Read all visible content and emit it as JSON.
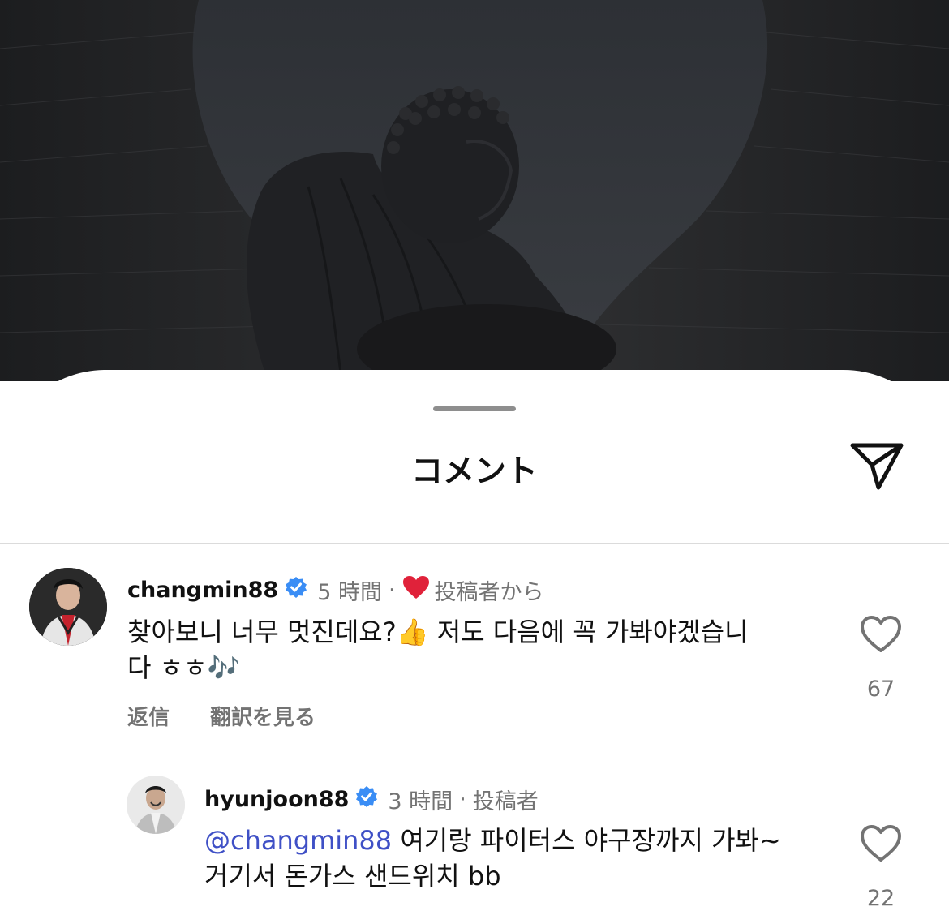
{
  "photo": {
    "description_icon": "buddha-statue-image"
  },
  "sheet": {
    "title": "コメント",
    "send_icon": "send-icon"
  },
  "comments": [
    {
      "username": "changmin88",
      "verified": true,
      "time": "5 時間",
      "separator": "·",
      "author_liked_label": "投稿者から",
      "text": "찾아보니 너무 멋진데요?👍 저도 다음에 꼭 가봐야겠습니다 ㅎㅎ🎶",
      "text_line1": "찾아보니 너무 멋진데요?",
      "text_emoji1": "👍",
      "text_line1b": " 저도 다음에 꼭 가봐야겠습니",
      "text_line2": "다 ㅎㅎ",
      "text_emoji2": "🎶",
      "reply_label": "返信",
      "translate_label": "翻訳を見る",
      "likes": "67"
    },
    {
      "username": "hyunjoon88",
      "verified": true,
      "time": "3 時間",
      "separator": "·",
      "author_label": "投稿者",
      "mention": "@changmin88",
      "text_line1": " 여기랑 파이터스 야구장까지 가봐~",
      "text_line2": "거기서 돈가스 샌드위치 bb",
      "likes": "22"
    }
  ],
  "colors": {
    "accent_mention": "#3f50c6",
    "verified_blue": "#3a8df5",
    "heart_red": "#e0223a",
    "muted_text": "#737373"
  }
}
